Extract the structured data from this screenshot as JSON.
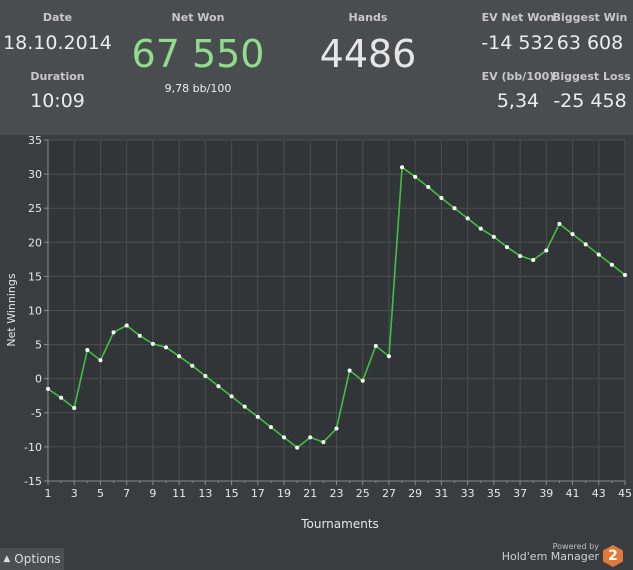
{
  "stats": {
    "date": {
      "label": "Date",
      "value": "18.10.2014"
    },
    "duration": {
      "label": "Duration",
      "value": "10:09"
    },
    "net_won": {
      "label": "Net Won",
      "value": "67 550",
      "sub": "9,78 bb/100"
    },
    "hands": {
      "label": "Hands",
      "value": "4486"
    },
    "ev_net_won": {
      "label": "EV Net Won",
      "value": "-14 532"
    },
    "ev_bb100": {
      "label": "EV (bb/100)",
      "value": "5,34"
    },
    "biggest_win": {
      "label": "Biggest Win",
      "value": "63 608"
    },
    "biggest_loss": {
      "label": "Biggest Loss",
      "value": "-25 458"
    }
  },
  "colors": {
    "net_won": "#8fdc8a",
    "hands": "#e6e6e6",
    "line": "#3fc13f"
  },
  "chart_data": {
    "type": "line",
    "xlabel": "Tournaments",
    "ylabel": "Net Winnings",
    "xlim": [
      1,
      45
    ],
    "ylim": [
      -15,
      35
    ],
    "xticks": [
      1,
      3,
      5,
      7,
      9,
      11,
      13,
      15,
      17,
      19,
      21,
      23,
      25,
      27,
      29,
      31,
      33,
      35,
      37,
      39,
      41,
      43,
      45
    ],
    "yticks": [
      -15,
      -10,
      -5,
      0,
      5,
      10,
      15,
      20,
      25,
      30,
      35
    ],
    "grid": true,
    "x": [
      1,
      2,
      3,
      4,
      5,
      6,
      7,
      8,
      9,
      10,
      11,
      12,
      13,
      14,
      15,
      16,
      17,
      18,
      19,
      20,
      21,
      22,
      23,
      24,
      25,
      26,
      27,
      28,
      29,
      30,
      31,
      32,
      33,
      34,
      35,
      36,
      37,
      38,
      39,
      40,
      41,
      42,
      43,
      44,
      45
    ],
    "y": [
      -1.5,
      -2.8,
      -4.3,
      4.2,
      2.7,
      6.8,
      7.8,
      6.3,
      5.1,
      4.6,
      3.3,
      1.9,
      0.4,
      -1.1,
      -2.6,
      -4.1,
      -5.6,
      -7.1,
      -8.6,
      -10.1,
      -8.6,
      -9.3,
      -7.3,
      1.2,
      -0.3,
      4.8,
      3.3,
      31.0,
      29.6,
      28.1,
      26.5,
      25.0,
      23.5,
      22.0,
      20.8,
      19.3,
      18.0,
      17.4,
      18.8,
      22.7,
      21.2,
      19.7,
      18.2,
      16.7,
      15.2
    ]
  },
  "footer": {
    "options_label": "Options",
    "powered_by": "Powered by",
    "brand": "Hold'em Manager",
    "logo_text": "2"
  }
}
